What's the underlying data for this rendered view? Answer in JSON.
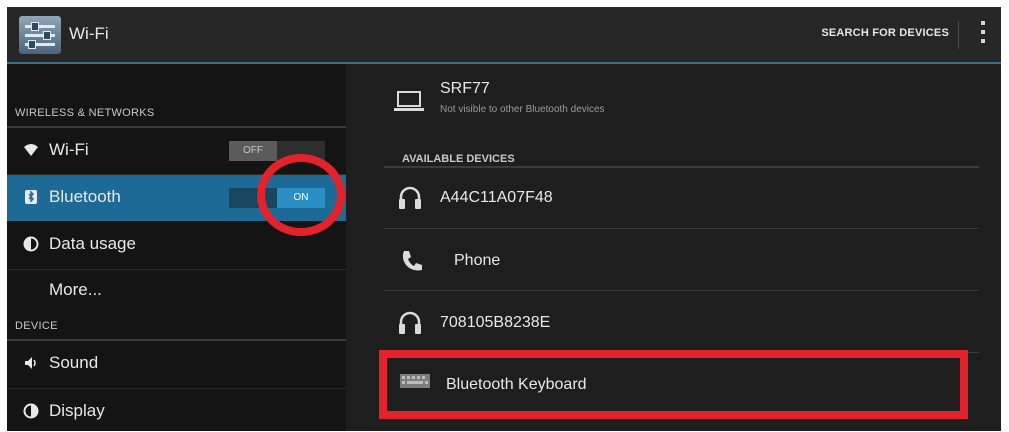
{
  "actionbar": {
    "title": "Wi-Fi",
    "search_label": "SEARCH FOR DEVICES"
  },
  "left": {
    "section_wireless": "WIRELESS & NETWORKS",
    "wifi": {
      "label": "Wi-Fi",
      "switch": "OFF"
    },
    "bluetooth": {
      "label": "Bluetooth",
      "switch": "ON"
    },
    "data_usage": {
      "label": "Data usage"
    },
    "more": {
      "label": "More..."
    },
    "section_device": "DEVICE",
    "sound": {
      "label": "Sound"
    },
    "display": {
      "label": "Display"
    }
  },
  "right": {
    "this_device": {
      "name": "SRF77",
      "status": "Not visible to other Bluetooth devices"
    },
    "available_header": "AVAILABLE DEVICES",
    "devices": [
      {
        "name": "A44C11A07F48",
        "icon": "headset-icon"
      },
      {
        "name": "Phone",
        "icon": "phone-icon"
      },
      {
        "name": "708105B8238E",
        "icon": "headset-icon"
      },
      {
        "name": "Bluetooth Keyboard",
        "icon": "keyboard-icon"
      }
    ]
  },
  "colors": {
    "selected": "#1d6a96",
    "switch_on": "#2a8fc4",
    "highlight_red": "#e3232c"
  }
}
